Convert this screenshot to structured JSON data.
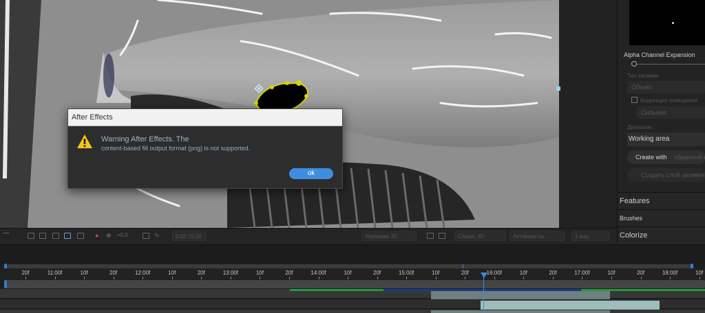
{
  "dialog": {
    "title": "After Effects",
    "line1": "Warning After Effects. The",
    "line2": "content-based fill output format (png) is not supported.",
    "ok_label": "ok"
  },
  "panel": {
    "alpha_label": "Alpha Channel Expansion",
    "fill_type_label": "Тип заливки",
    "fill_type_value": "Объект",
    "lighting_label": "Коррекция освещения",
    "strength_value": "Сильная",
    "range_label": "Диапазон",
    "range_value": "Working area",
    "create_label": "Create with",
    "create_suffix": "образный кадр",
    "create_layer_label": "Создать слой заливки",
    "features_label": "Features",
    "brushes_label": "Brushes",
    "colorize_label": "Colorize"
  },
  "toolbar": {
    "zoom_value": "+0,0",
    "timecode": "0;02;15;26",
    "renderer_draft": "Черновик 3D",
    "renderer": "Classic 3D",
    "camera": "Активная ка...",
    "views": "1 вид"
  },
  "timeline": {
    "ticks": [
      "20f",
      "11:00f",
      "10f",
      "20f",
      "12:00f",
      "10f",
      "20f",
      "13:00f",
      "10f",
      "20f",
      "14:00f",
      "10f",
      "20f",
      "15:00f",
      "10f",
      "20f",
      "16:00f",
      "10f",
      "20f",
      "17:00f",
      "10f",
      "20f",
      "18:00f",
      "10f"
    ]
  },
  "colors": {
    "accent": "#3b8bdc",
    "ok_button": "#3f8de0",
    "warning": "#f5c518",
    "mask_outline": "#d9d400",
    "track_green": "#1f9a3b"
  }
}
